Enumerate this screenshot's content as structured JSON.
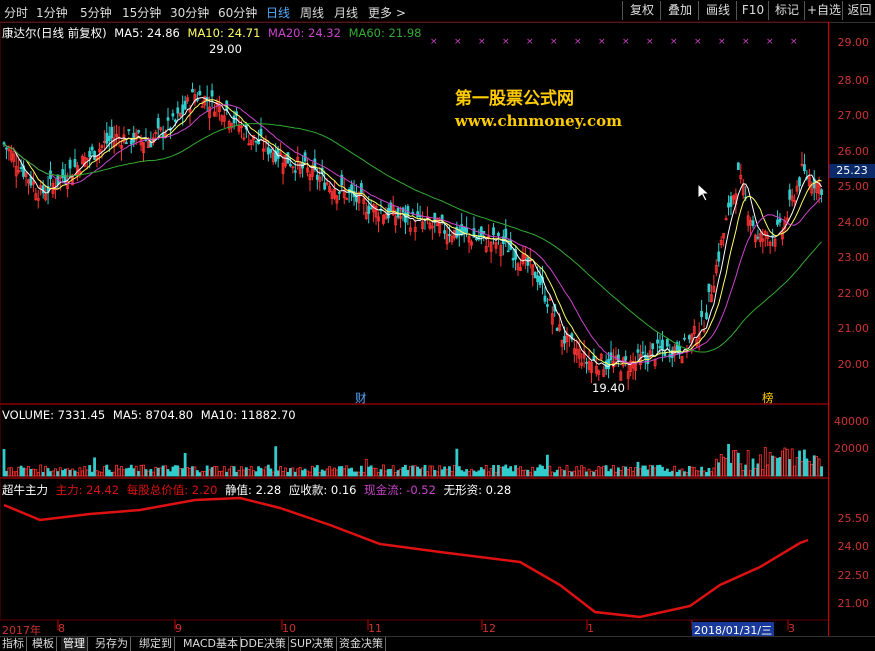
{
  "timeframes": [
    "分时",
    "1分钟",
    "5分钟",
    "15分钟",
    "30分钟",
    "60分钟",
    "日线",
    "周线",
    "月线",
    "更多 >"
  ],
  "active_timeframe": "日线",
  "toolbar": [
    "复权",
    "叠加",
    "画线",
    "F10",
    "标记",
    "+自选",
    "返回"
  ],
  "main": {
    "name": "康达尔(日线 前复权)",
    "ma5": "MA5: 24.86",
    "ma10": "MA10: 24.71",
    "ma20": "MA20: 24.32",
    "ma60": "MA60: 21.98",
    "high_label": "29.00",
    "low_label": "19.40",
    "current_price": "25.23",
    "marker_cai": "财",
    "marker_bang": "榜",
    "watermark_cn": "第一股票公式网",
    "watermark_url": "www.chnmoney.com",
    "price_ticks": [
      "29.00",
      "28.00",
      "27.00",
      "26.00",
      "25.00",
      "24.00",
      "23.00",
      "22.00",
      "21.00",
      "20.00"
    ]
  },
  "volume": {
    "label": "VOLUME: 7331.45",
    "ma5": "MA5: 8704.80",
    "ma10": "MA10: 11882.70",
    "ticks": [
      "40000",
      "20000"
    ]
  },
  "indicator": {
    "name": "超牛主力",
    "zhuli": "主力: 24.42",
    "meigu": "每股总价值: 2.20",
    "jingzhi": "静值: 2.28",
    "yingshou": "应收款: 0.16",
    "xianjin": "现金流: -0.52",
    "wuxing": "无形资: 0.28",
    "ticks": [
      "25.50",
      "24.00",
      "22.50",
      "21.00"
    ]
  },
  "x_axis": [
    "2017年",
    "8",
    "9",
    "10",
    "11",
    "12",
    "1",
    "2018/01/31/三",
    "3"
  ],
  "bottom_tabs": [
    "指标",
    "模板",
    "管理",
    "另存为",
    "绑定到",
    "MACD基本",
    "DDE决策",
    "SUP决策",
    "资金决策"
  ],
  "active_tab": "管理",
  "colors": {
    "up": "#ff3333",
    "down": "#33cccc",
    "ma5": "#ffffff",
    "ma10": "#ffff66",
    "ma20": "#cc44cc",
    "ma60": "#33aa33",
    "ind": "#dd1111"
  }
}
